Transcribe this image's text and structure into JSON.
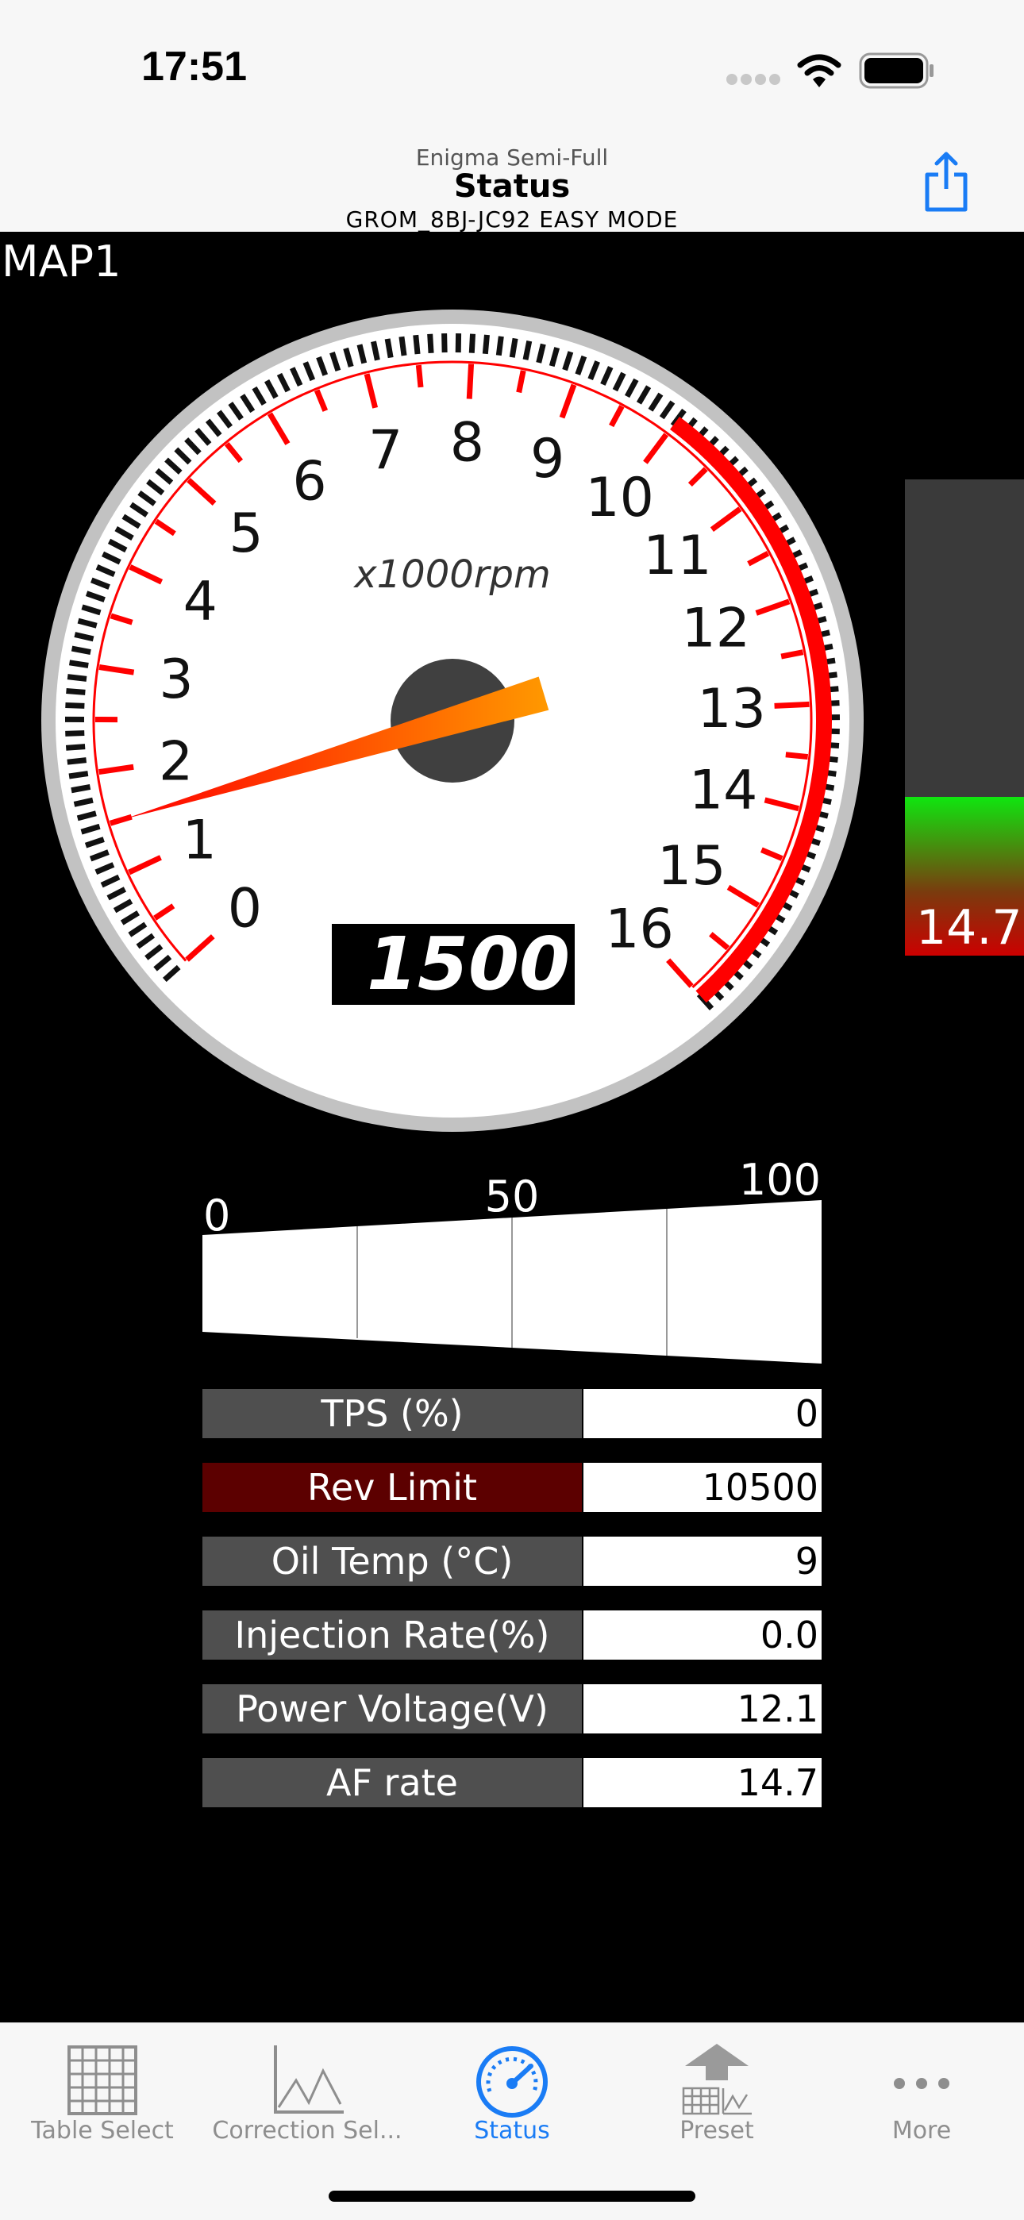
{
  "status_bar": {
    "time": "17:51"
  },
  "nav": {
    "app_name": "Enigma Semi-Full",
    "title": "Status",
    "mode": "GROM_8BJ-JC92 EASY MODE"
  },
  "map_label": "MAP1",
  "gauge": {
    "unit_label": "x1000rpm",
    "ticks": [
      "0",
      "1",
      "2",
      "3",
      "4",
      "5",
      "6",
      "7",
      "8",
      "9",
      "10",
      "11",
      "12",
      "13",
      "14",
      "15",
      "16"
    ],
    "rpm_readout": "1500",
    "rpm_value": 1500,
    "redline_from": 10
  },
  "af_bar": {
    "value": "14.7",
    "fill_fraction": 0.33
  },
  "tps_scale": {
    "labels": [
      "0",
      "50",
      "100"
    ]
  },
  "readings": [
    {
      "label": "TPS (%)",
      "value": "0",
      "warn": false
    },
    {
      "label": "Rev Limit",
      "value": "10500",
      "warn": true
    },
    {
      "label": "Oil Temp (°C)",
      "value": "9",
      "warn": false
    },
    {
      "label": "Injection Rate(%)",
      "value": "0.0",
      "warn": false
    },
    {
      "label": "Power Voltage(V)",
      "value": "12.1",
      "warn": false
    },
    {
      "label": "AF rate",
      "value": "14.7",
      "warn": false
    }
  ],
  "tabs": [
    {
      "label": "Table Select",
      "icon": "table-icon"
    },
    {
      "label": "Correction Sel...",
      "icon": "chart-icon"
    },
    {
      "label": "Status",
      "icon": "speedometer-icon"
    },
    {
      "label": "Preset",
      "icon": "preset-icon"
    },
    {
      "label": "More",
      "icon": "more-icon"
    }
  ],
  "colors": {
    "accent": "#1a7cf5",
    "redline": "#ff0000",
    "needle_start": "#ff0000",
    "needle_end": "#ff9900"
  }
}
